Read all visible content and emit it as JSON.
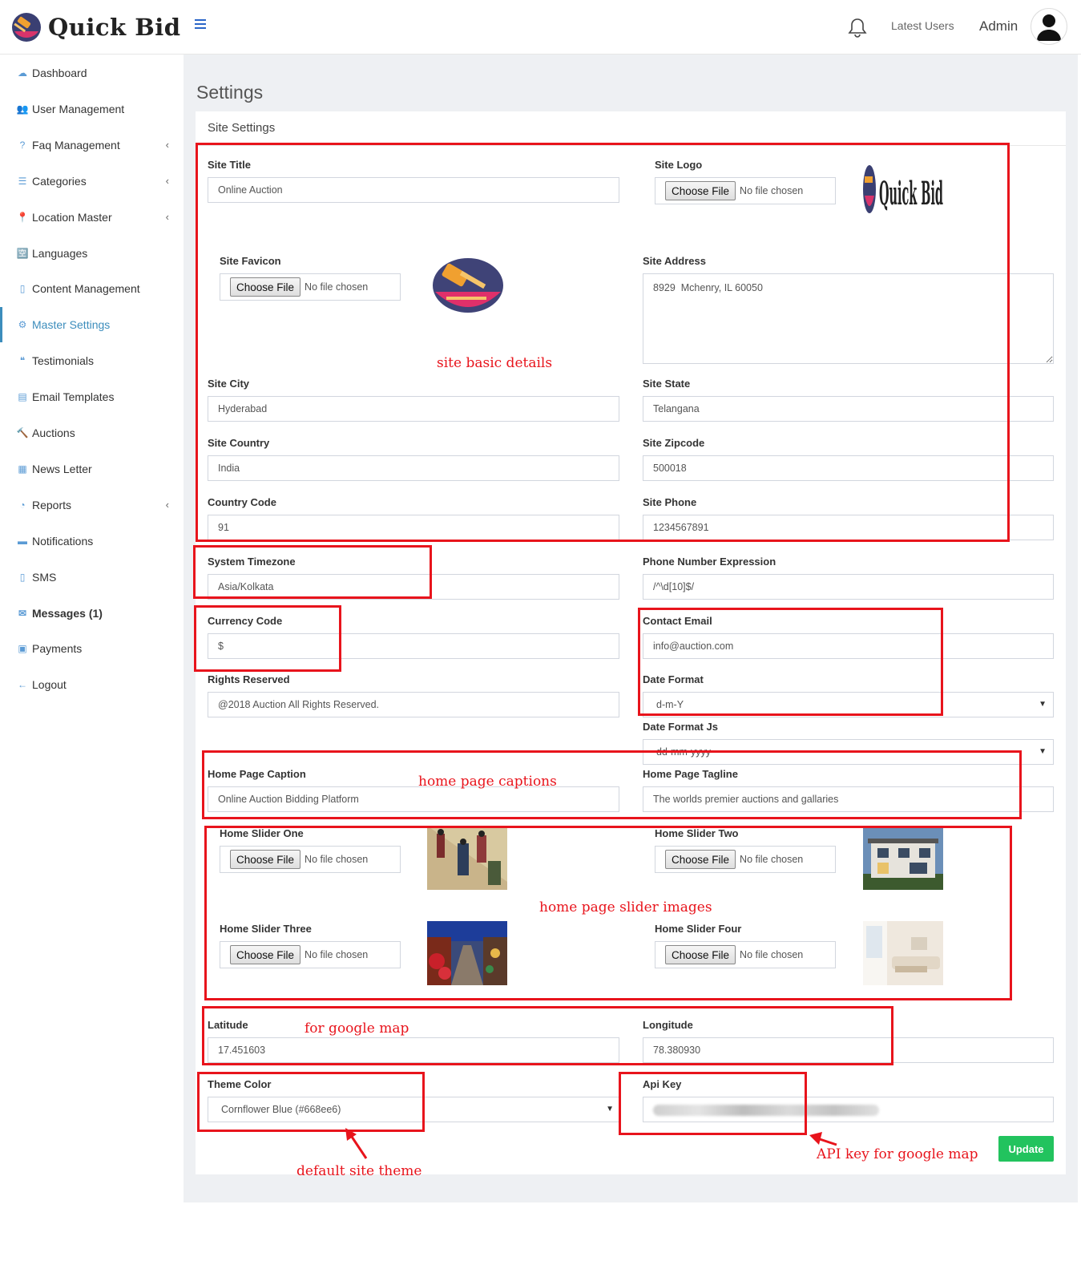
{
  "app": {
    "brand": "Quick Bid"
  },
  "header": {
    "latest_users": "Latest Users",
    "admin": "Admin"
  },
  "sidebar": {
    "items": [
      {
        "label": "Dashboard",
        "icon": "cloud-icon"
      },
      {
        "label": "User Management",
        "icon": "users-icon"
      },
      {
        "label": "Faq Management",
        "icon": "question-icon",
        "has_children": true
      },
      {
        "label": "Categories",
        "icon": "list-icon",
        "has_children": true
      },
      {
        "label": "Location Master",
        "icon": "map-pin-icon",
        "has_children": true
      },
      {
        "label": "Languages",
        "icon": "language-icon"
      },
      {
        "label": "Content Management",
        "icon": "file-icon"
      },
      {
        "label": "Master Settings",
        "icon": "cogs-icon",
        "active": true
      },
      {
        "label": "Testimonials",
        "icon": "quote-icon"
      },
      {
        "label": "Email Templates",
        "icon": "book-icon"
      },
      {
        "label": "Auctions",
        "icon": "gavel-icon"
      },
      {
        "label": "News Letter",
        "icon": "newspaper-icon"
      },
      {
        "label": "Reports",
        "icon": "pie-chart-icon",
        "has_children": true
      },
      {
        "label": "Notifications",
        "icon": "tray-icon"
      },
      {
        "label": "SMS",
        "icon": "mobile-icon"
      },
      {
        "label": "Messages (1)",
        "icon": "envelope-icon"
      },
      {
        "label": "Payments",
        "icon": "money-icon"
      },
      {
        "label": "Logout",
        "icon": "arrow-left-icon"
      }
    ]
  },
  "page": {
    "title": "Settings",
    "card_title": "Site Settings"
  },
  "file_input": {
    "button": "Choose File",
    "no_file": "No file chosen"
  },
  "form": {
    "site_title": {
      "label": "Site Title",
      "value": "Online Auction"
    },
    "site_logo": {
      "label": "Site Logo"
    },
    "site_favicon": {
      "label": "Site Favicon"
    },
    "site_address": {
      "label": "Site Address",
      "value": "8929  Mchenry, IL 60050"
    },
    "site_city": {
      "label": "Site City",
      "value": "Hyderabad"
    },
    "site_state": {
      "label": "Site State",
      "value": "Telangana"
    },
    "site_country": {
      "label": "Site Country",
      "value": "India"
    },
    "site_zipcode": {
      "label": "Site Zipcode",
      "value": "500018"
    },
    "country_code": {
      "label": "Country Code",
      "value": "91"
    },
    "site_phone": {
      "label": "Site Phone",
      "value": "1234567891"
    },
    "system_timezone": {
      "label": "System Timezone",
      "value": "Asia/Kolkata"
    },
    "phone_expression": {
      "label": "Phone Number Expression",
      "value": "/^\\d[10]$/"
    },
    "currency_code": {
      "label": "Currency Code",
      "value": "$"
    },
    "contact_email": {
      "label": "Contact Email",
      "value": "info@auction.com"
    },
    "rights_reserved": {
      "label": "Rights Reserved",
      "value": "@2018 Auction All Rights Reserved."
    },
    "date_format": {
      "label": "Date Format",
      "value": "d-m-Y"
    },
    "date_format_js": {
      "label": "Date Format Js",
      "value": "dd-mm-yyyy"
    },
    "home_caption": {
      "label": "Home Page Caption",
      "value": "Online Auction Bidding Platform"
    },
    "home_tagline": {
      "label": "Home Page Tagline",
      "value": "The worlds premier auctions and gallaries"
    },
    "slider_one": {
      "label": "Home Slider One"
    },
    "slider_two": {
      "label": "Home Slider Two"
    },
    "slider_three": {
      "label": "Home Slider Three"
    },
    "slider_four": {
      "label": "Home Slider Four"
    },
    "latitude": {
      "label": "Latitude",
      "value": "17.451603"
    },
    "longitude": {
      "label": "Longitude",
      "value": "78.380930"
    },
    "theme_color": {
      "label": "Theme Color",
      "value": "Cornflower Blue (#668ee6)"
    },
    "api_key": {
      "label": "Api Key"
    },
    "update": "Update"
  },
  "annotations": {
    "basic": "site basic details",
    "captions": "home page captions",
    "sliders": "home page slider images",
    "map": "for google map",
    "theme": "default site theme",
    "api": "API key for google map"
  },
  "colors": {
    "accent": "#3c8dbc",
    "annotation": "#e8141c",
    "update_button": "#22c35e",
    "content_bg": "#eef0f3"
  }
}
